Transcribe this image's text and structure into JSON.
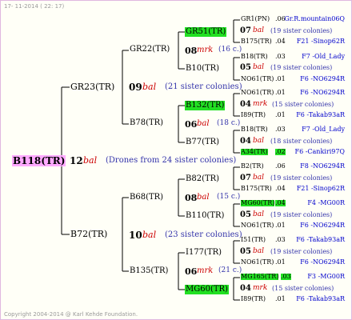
{
  "header": {
    "date": "17- 11-2014 ( 22: 17)"
  },
  "footer": {
    "copyright": "Copyright 2004-2014 @ Karl Kehde Foundation."
  },
  "gen1": {
    "name": "B118(TR)",
    "code": "12",
    "mark": "bal",
    "note": "(Drones from 24 sister colonies)"
  },
  "gen2": [
    {
      "name": "GR23(TR)",
      "code": "09",
      "mark": "bal",
      "note": "(21 sister colonies)"
    },
    {
      "name": "B72(TR)",
      "code": "10",
      "mark": "bal",
      "note": "(23 sister colonies)"
    }
  ],
  "gen3": [
    {
      "name": "GR22(TR)",
      "code": "08",
      "mark": "mrk",
      "note": "(16 c.)"
    },
    {
      "name": "B78(TR)",
      "code": "06",
      "mark": "bal",
      "note": "(18 c.)"
    },
    {
      "name": "B68(TR)",
      "code": "08",
      "mark": "bal",
      "note": "(15 c.)"
    },
    {
      "name": "B135(TR)",
      "code": "06",
      "mark": "mrk",
      "note": "(21 c.)"
    }
  ],
  "gen4": [
    {
      "name": "GR51(TR)",
      "code": "07",
      "mark": "bal",
      "note": "(19 sister colonies)"
    },
    {
      "name": "B10(TR)",
      "code": "05",
      "mark": "bal",
      "note": "(19 sister colonies)"
    },
    {
      "name": "B132(TR)",
      "code": "04",
      "mark": "mrk",
      "note": "(15 sister colonies)"
    },
    {
      "name": "B77(TR)",
      "code": "04",
      "mark": "bal",
      "note": "(18 sister colonies)"
    },
    {
      "name": "B82(TR)",
      "code": "07",
      "mark": "bal",
      "note": "(19 sister colonies)"
    },
    {
      "name": "B110(TR)",
      "code": "05",
      "mark": "bal",
      "note": "(19 sister colonies)"
    },
    {
      "name": "I177(TR)",
      "code": "05",
      "mark": "bal",
      "note": "(19 sister colonies)"
    },
    {
      "name": "MG60(TR)",
      "code": "04",
      "mark": "mrk",
      "note": "(15 sister colonies)"
    }
  ],
  "gen5": [
    {
      "name": "GR1(PN)",
      "val": ".06",
      "loc": "Gr.R.mountain06Q"
    },
    {
      "name": "B175(TR)",
      "val": ".04",
      "loc": "F21 -Sinop62R"
    },
    {
      "name": "B18(TR)",
      "val": ".03",
      "loc": "F7 -Old_Lady"
    },
    {
      "name": "NO61(TR)",
      "val": ".01",
      "loc": "F6 -NO6294R"
    },
    {
      "name": "NO61(TR)",
      "val": ".01",
      "loc": "F6 -NO6294R"
    },
    {
      "name": "I89(TR)",
      "val": ".01",
      "loc": "F6 -Takab93aR"
    },
    {
      "name": "B18(TR)",
      "val": ".03",
      "loc": "F7 -Old_Lady"
    },
    {
      "name": "A34(TR)",
      "val": ".02",
      "loc": "F6 -Cankiri97Q"
    },
    {
      "name": "B2(TR)",
      "val": ".06",
      "loc": "F8 -NO6294R"
    },
    {
      "name": "B175(TR)",
      "val": ".04",
      "loc": "F21 -Sinop62R"
    },
    {
      "name": "MG60(TR)",
      "val": ".04",
      "loc": "F4 -MG00R"
    },
    {
      "name": "NO61(TR)",
      "val": ".01",
      "loc": "F6 -NO6294R"
    },
    {
      "name": "I51(TR)",
      "val": ".03",
      "loc": "F6 -Takab93aR"
    },
    {
      "name": "NO61(TR)",
      "val": ".01",
      "loc": "F6 -NO6294R"
    },
    {
      "name": "MG165(TR)",
      "val": ".03",
      "loc": "F3 -MG00R"
    },
    {
      "name": "I89(TR)",
      "val": ".01",
      "loc": "F6 -Takab93aR"
    }
  ]
}
